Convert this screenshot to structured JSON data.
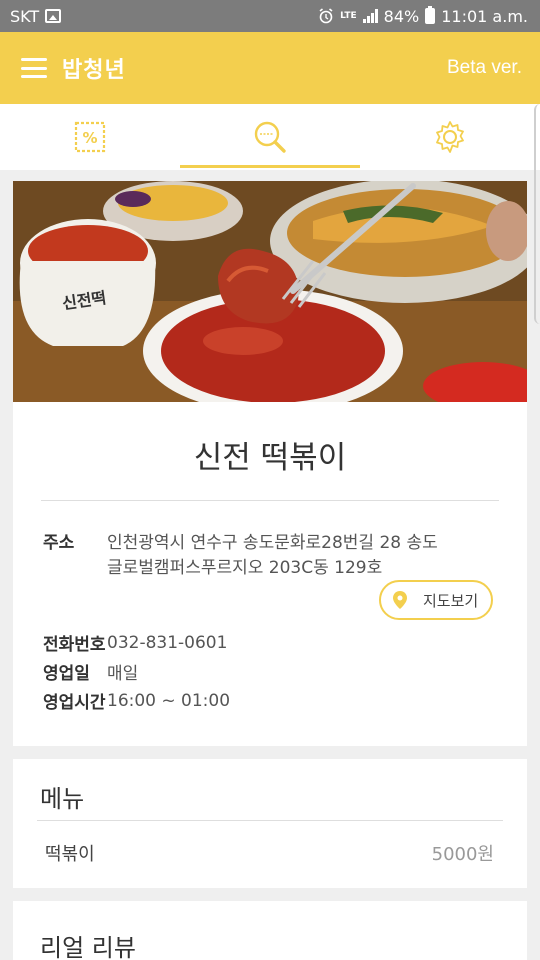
{
  "status_bar": {
    "carrier": "SKT",
    "network": "LTE",
    "battery": "84%",
    "time": "11:01 a.m."
  },
  "app_bar": {
    "title": "밥청년",
    "version_label": "Beta ver."
  },
  "tabs": [
    {
      "name": "coupon",
      "icon": "coupon-icon",
      "active": false
    },
    {
      "name": "search",
      "icon": "search-icon",
      "active": true
    },
    {
      "name": "settings",
      "icon": "gear-icon",
      "active": false
    }
  ],
  "restaurant": {
    "name": "신전 떡볶이",
    "address_label": "주소",
    "address_line1": "인천광역시 연수구 송도문화로28번길 28 송도",
    "address_line2": "글로벌캠퍼스푸르지오 203C동 129호",
    "map_button": "지도보기",
    "phone_label": "전화번호",
    "phone": "032-831-0601",
    "days_label": "영업일",
    "days": "매일",
    "hours_label": "영업시간",
    "hours": "16:00 ~ 01:00"
  },
  "menu": {
    "title": "메뉴",
    "items": [
      {
        "name": "떡볶이",
        "price": "5000원"
      }
    ]
  },
  "review": {
    "title": "리얼 리뷰"
  },
  "colors": {
    "accent": "#f3cf4e",
    "status_bar": "#7c7c7c",
    "background": "#efefef"
  }
}
